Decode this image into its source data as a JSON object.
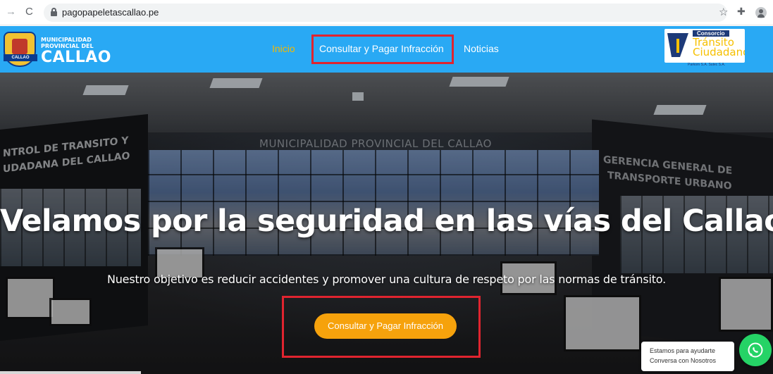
{
  "browser": {
    "url": "pagopapeletascallao.pe"
  },
  "header": {
    "logo_left": {
      "line1": "MUNICIPALIDAD",
      "line2": "PROVINCIAL DEL",
      "name": "CALLAO",
      "ribbon": "CALLAO"
    },
    "nav": {
      "inicio": "Inicio",
      "consultar": "Consultar y Pagar Infracción",
      "noticias": "Noticias"
    },
    "logo_right": {
      "consorcio": "Consorcio",
      "transito": "Tránsito",
      "ciudadano": "Ciudadano",
      "parkom": "Parkom S.A. Sutec S.A."
    },
    "colors": {
      "header_bg": "#29a9f4",
      "active_nav": "#f5b800",
      "highlight_box": "#e0242f"
    }
  },
  "hero": {
    "wall_text_left_1": "NTROL DE TRANSITO Y",
    "wall_text_left_2": "UDADANA DEL CALLAO",
    "wall_text_center": "MUNICIPALIDAD PROVINCIAL DEL CALLAO",
    "wall_text_right_1": "GERENCIA GENERAL DE",
    "wall_text_right_2": "TRANSPORTE URBANO",
    "headline": "Velamos por la seguridad en las vías del Callao",
    "subline": "Nuestro objetivo es reducir accidentes y promover una cultura de respeto por las normas de tránsito.",
    "cta_label": "Consultar y Pagar Infracción",
    "cta_color": "#f6a20c"
  },
  "chat": {
    "line1": "Estamos para ayudarte",
    "line2": "Conversa con Nosotros",
    "icon": "whatsapp-icon"
  }
}
